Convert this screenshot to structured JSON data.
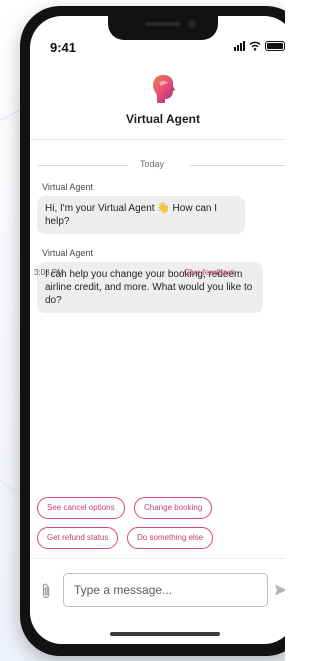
{
  "status_bar": {
    "time": "9:41",
    "icons": [
      "cellular-signal-icon",
      "wifi-icon",
      "battery-icon"
    ]
  },
  "header": {
    "title": "Virtual Agent",
    "logo_icon": "virtual-agent-avatar-icon",
    "logo_colors": [
      "#8a2a6b",
      "#e24a7d",
      "#f27c4c"
    ]
  },
  "conversation": {
    "date_divider": "Today",
    "messages": [
      {
        "sender": "Virtual Agent",
        "text": "Hi, I'm your Virtual Agent 👋 How can I help?"
      },
      {
        "sender": "Virtual Agent",
        "text": "I can help you change your booking, redeem airline credit, and more. What would you like to do?"
      }
    ],
    "timestamp": "3:03 PM",
    "feedback_link": "Give feedback"
  },
  "quick_replies": [
    "See cancel options",
    "Change booking",
    "Get refund status",
    "Do something else"
  ],
  "composer": {
    "placeholder": "Type a message...",
    "attach_icon": "paperclip-icon",
    "send_icon": "send-icon"
  },
  "colors": {
    "accent": "#c2407a",
    "bubble_bg": "#eeeeee",
    "frame": "#121212"
  }
}
